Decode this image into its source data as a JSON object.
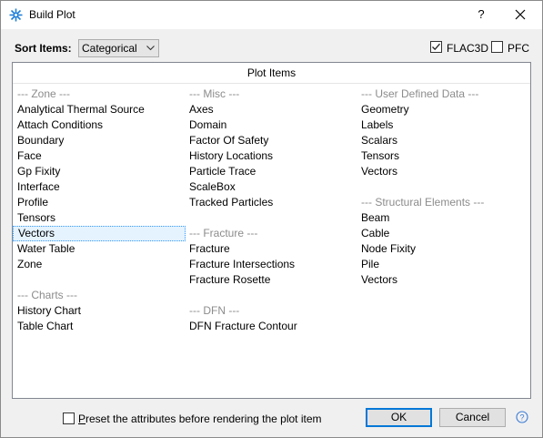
{
  "window": {
    "title": "Build Plot",
    "help_glyph": "?"
  },
  "sort": {
    "label": "Sort Items:",
    "value": "Categorical"
  },
  "options": {
    "flac3d_label": "FLAC3D",
    "flac3d_checked": true,
    "pfc_label": "PFC",
    "pfc_checked": false
  },
  "panel": {
    "header": "Plot Items"
  },
  "columns": [
    [
      {
        "text": "--- Zone ---",
        "kind": "header"
      },
      {
        "text": "Analytical Thermal Source"
      },
      {
        "text": "Attach Conditions"
      },
      {
        "text": "Boundary"
      },
      {
        "text": "Face"
      },
      {
        "text": "Gp Fixity"
      },
      {
        "text": "Interface"
      },
      {
        "text": "Profile"
      },
      {
        "text": "Tensors"
      },
      {
        "text": "Vectors",
        "selected": true
      },
      {
        "text": "Water Table"
      },
      {
        "text": "Zone"
      },
      {
        "text": "",
        "kind": "spacer"
      },
      {
        "text": "--- Charts ---",
        "kind": "header"
      },
      {
        "text": "History Chart"
      },
      {
        "text": "Table Chart"
      }
    ],
    [
      {
        "text": "--- Misc ---",
        "kind": "header"
      },
      {
        "text": "Axes"
      },
      {
        "text": "Domain"
      },
      {
        "text": "Factor Of Safety"
      },
      {
        "text": "History Locations"
      },
      {
        "text": "Particle Trace"
      },
      {
        "text": "ScaleBox"
      },
      {
        "text": "Tracked Particles"
      },
      {
        "text": "",
        "kind": "spacer"
      },
      {
        "text": "--- Fracture ---",
        "kind": "header"
      },
      {
        "text": "Fracture"
      },
      {
        "text": "Fracture Intersections"
      },
      {
        "text": "Fracture Rosette"
      },
      {
        "text": "",
        "kind": "spacer"
      },
      {
        "text": "--- DFN ---",
        "kind": "header"
      },
      {
        "text": "DFN Fracture Contour"
      }
    ],
    [
      {
        "text": "--- User Defined Data ---",
        "kind": "header"
      },
      {
        "text": "Geometry"
      },
      {
        "text": "Labels"
      },
      {
        "text": "Scalars"
      },
      {
        "text": "Tensors"
      },
      {
        "text": "Vectors"
      },
      {
        "text": "",
        "kind": "spacer"
      },
      {
        "text": "--- Structural Elements ---",
        "kind": "header"
      },
      {
        "text": "Beam"
      },
      {
        "text": "Cable"
      },
      {
        "text": "Node Fixity"
      },
      {
        "text": "Pile"
      },
      {
        "text": "Vectors"
      }
    ]
  ],
  "footer": {
    "preset_label": "Preset the attributes before rendering the plot item",
    "preset_checked": false,
    "ok_label": "OK",
    "cancel_label": "Cancel"
  },
  "colors": {
    "accent": "#0078d7",
    "selection_bg": "#e5f3ff",
    "header_gray": "#8c8c8c"
  },
  "icons": {
    "app": "app-icon",
    "close": "close-icon",
    "help": "help-icon"
  }
}
